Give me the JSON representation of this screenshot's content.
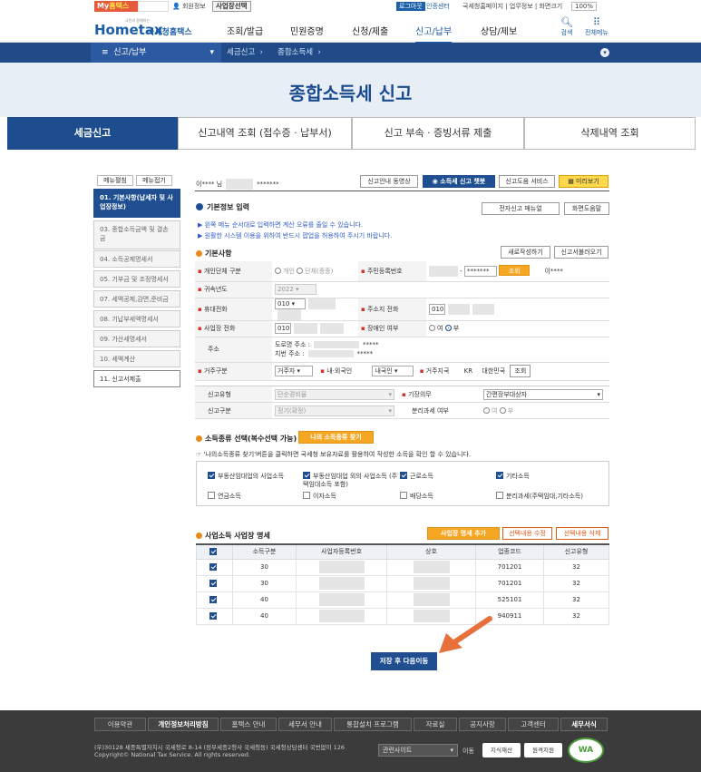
{
  "util": {
    "my_hometax": "My",
    "my_hometax_b": "홈택스",
    "member": "회원정보",
    "biz_select": "사업장선택",
    "login": "로그아웃",
    "cert": "인증센터",
    "links": "국세청홈페이지 | 업무정보 | 화면크기",
    "zoom": "100%"
  },
  "header": {
    "logo": "Hometax",
    "logo_kr": "국세청홈택스",
    "logo_small": "국민과 함께하는",
    "menu": [
      "조회/발급",
      "민원증명",
      "신청/제출",
      "신고/납부",
      "상담/제보"
    ],
    "search": "검색",
    "allmenu": "전체메뉴"
  },
  "subnav": {
    "section": "신고/납부",
    "crumb1": "세금신고",
    "crumb2": "종합소득세"
  },
  "hero_title": "종합소득세 신고",
  "tabs": [
    "세금신고",
    "신고내역 조회 (접수증 · 납부서)",
    "신고 부속 · 증빙서류 제출",
    "삭제내역 조회"
  ],
  "sidebar": {
    "open": "메뉴펼침",
    "close": "메뉴접기",
    "items": [
      "01. 기본사항(납세자 및 사업장정보)",
      "03. 종합소득금액 및 결손금",
      "04. 소득공제명세서",
      "05. 기부금 및 조정명세서",
      "07. 세액공제,감면,준비금",
      "08. 기납부세액명세서",
      "09. 가산세명세서",
      "10. 세액계산",
      "11. 신고서제출"
    ]
  },
  "top": {
    "user": "이**** 님",
    "masked": "*******",
    "btn_video": "신고안내 동영상",
    "btn_chatbot": "소득세 신고 챗봇",
    "btn_help": "신고도움 서비스",
    "btn_preview": "미리보기"
  },
  "basic_info": {
    "title": "기본정보 입력",
    "btn_manual": "전자신고 매뉴얼",
    "btn_screen_help": "화면도움말",
    "note1": "왼쪽 메뉴 순서대로 입력하면 계산 오류를 줄일 수 있습니다.",
    "note2": "원활한 시스템 이용을 위하여 반드시 팝업을 허용하여 주시기 바랍니다."
  },
  "basic": {
    "title": "기본사항",
    "btn_new": "새로작성하기",
    "btn_load": "신고서불러오기",
    "type_label": "개인단체 구분",
    "type_opt1": "개인",
    "type_opt2": "단체(종중)",
    "id_label": "주민등록번호",
    "id_mask": "*******",
    "btn_check": "조회",
    "id_name": "이****",
    "year_label": "귀속년도",
    "year_value": "2022",
    "mobile_label": "휴대전화",
    "mobile_prefix": "010",
    "home_label": "주소지 전화",
    "home_prefix": "010",
    "biz_phone_label": "사업장 전화",
    "biz_phone_prefix": "010",
    "disabled_label": "장애인 여부",
    "disabled_yes": "여",
    "disabled_no": "부",
    "addr_label": "주소",
    "road_label": "도로명 주소 :",
    "road_mask": "*****",
    "jibun_label": "지번 주소 :",
    "jibun_mask": "*****",
    "res_label": "거주구분",
    "res_value": "거주자",
    "nat_label": "내·외국인",
    "nat_value": "내국인",
    "country_label": "거주지국",
    "country_code": "KR",
    "country_name": "대한민국",
    "btn_country": "조회",
    "report_type_label": "신고유형",
    "report_type_value": "단순경비율",
    "duty_label": "기장의무",
    "duty_value": "간편장부대상자",
    "report_div_label": "신고구분",
    "report_div_value": "정기(확정)",
    "sep_label": "분리과세 여부",
    "sep_yes": "여",
    "sep_no": "부"
  },
  "income": {
    "title": "소득종류 선택(복수선택 가능)",
    "btn_find": "나의 소득종류 찾기",
    "note": "'나의소득종류 찾기'버튼을 클릭하면 국세청 보유자료를 활용하여 작성한 소득을 확인 할 수 있습니다.",
    "items": [
      "부동산임대업의 사업소득",
      "부동산임대업 외의 사업소득 (주택임대소득 포함)",
      "근로소득",
      "기타소득",
      "연금소득",
      "이자소득",
      "배당소득",
      "분리과세(주택임대,기타소득)"
    ]
  },
  "business": {
    "title": "사업소득 사업장 명세",
    "btn_add": "사업장 명세 추가",
    "btn_edit": "선택내용 수정",
    "btn_del": "선택내용 삭제",
    "headers": [
      "소득구분",
      "사업자등록번호",
      "상호",
      "업종코드",
      "신고유형"
    ],
    "rows": [
      [
        "30",
        "701201",
        "32"
      ],
      [
        "30",
        "701201",
        "32"
      ],
      [
        "40",
        "525101",
        "32"
      ],
      [
        "40",
        "940911",
        "32"
      ]
    ]
  },
  "save_btn": "저장 후 다음이동",
  "footer": {
    "links": [
      "이용약관",
      "개인정보처리방침",
      "홈택스 안내",
      "세무서 안내",
      "통합설치 프로그램",
      "자료실",
      "공지사항",
      "고객센터",
      "세무서식"
    ],
    "addr": "(우)30128 세종특별자치시 국세청로 8-14 (정부세종2청사 국세청동) 국세청상담센터 국번없이 126",
    "copy": "Copyright© National Tax Service. All rights reserved.",
    "related": "관련사이트",
    "go": "이동",
    "badge1": "지식재산",
    "badge2": "원격지원",
    "wa": "WA"
  },
  "colors": {
    "brand": "#1d5fa8",
    "nav": "#214b88",
    "accent": "#e88a1a"
  }
}
